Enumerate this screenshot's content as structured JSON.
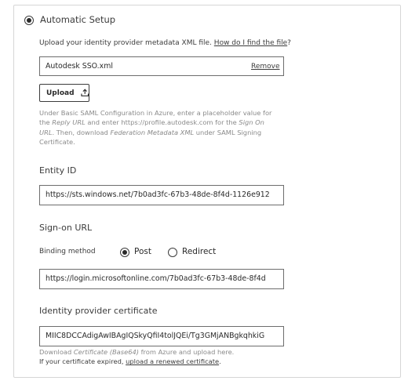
{
  "setup": {
    "automatic_label": "Automatic Setup",
    "automatic_selected": true,
    "upload_prompt": "Upload your identity provider metadata XML file.",
    "upload_help_link": "How do I find the file",
    "upload_prompt_suffix": "?",
    "file_name": "Autodesk SSO.xml",
    "remove_label": "Remove",
    "upload_button": "Upload",
    "instructions": {
      "p1": "Under Basic SAML Configuration in Azure, enter a placeholder value for",
      "p2_pre": "the ",
      "p2_em": "Reply URL",
      "p2_post": " and enter https://profile.autodesk.com for the ",
      "p2_em2": "Sign On",
      "p3_em": "URL",
      "p3_post": ". Then, download ",
      "p3_em2": "Federation Metadata XML",
      "p3_post2": " under SAML Signing",
      "p4": "Certificate."
    }
  },
  "entity": {
    "label": "Entity ID",
    "value": "https://sts.windows.net/7b0ad3fc-67b3-48de-8f4d-1126e912"
  },
  "signon": {
    "label": "Sign-on URL",
    "binding_label": "Binding method",
    "options": [
      {
        "label": "Post",
        "selected": true
      },
      {
        "label": "Redirect",
        "selected": false
      }
    ],
    "value": "https://login.microsoftonline.com/7b0ad3fc-67b3-48de-8f4d"
  },
  "certificate": {
    "label": "Identity provider certificate",
    "value": "MIIC8DCCAdigAwIBAgIQSkyQfiI4tolJQEi/Tg3GMjANBgkqhkiG",
    "help_pre": "Download ",
    "help_em": "Certificate (Base64)",
    "help_post": " from Azure and upload here.",
    "expired_pre": "If your certificate expired, ",
    "expired_link": "upload a renewed certificate",
    "expired_post": "."
  }
}
